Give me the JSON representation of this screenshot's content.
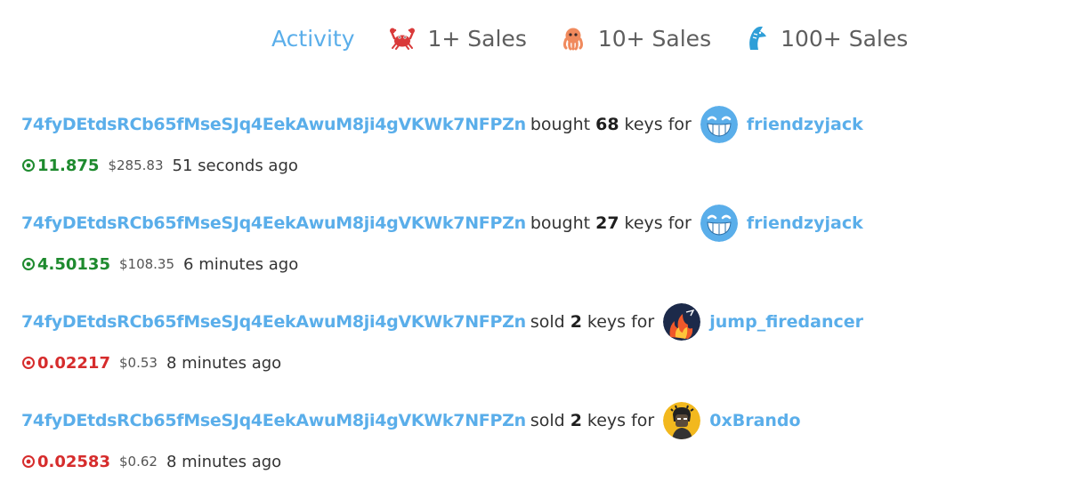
{
  "tabs": [
    {
      "label": "Activity",
      "icon": "activity-tab",
      "active": true
    },
    {
      "label": "1+ Sales",
      "icon": "crab-icon",
      "active": false
    },
    {
      "label": "10+ Sales",
      "icon": "octopus-icon",
      "active": false
    },
    {
      "label": "100+ Sales",
      "icon": "shark-icon",
      "active": false
    }
  ],
  "colors": {
    "accent": "#5aaeea",
    "buy": "#1e8a2e",
    "sell": "#d62c2c"
  },
  "activity": [
    {
      "trader": "74fyDEtdsRCb65fMseSJq4EekAwuM8ji4gVKWk7NFPZn",
      "verb": "bought",
      "qty": "68",
      "unit": "keys for",
      "subject": "friendzyjack",
      "avatar_icon": "grinning-face-avatar",
      "amount": "11.875",
      "usd": "$285.83",
      "time": "51 seconds ago",
      "side": "buy"
    },
    {
      "trader": "74fyDEtdsRCb65fMseSJq4EekAwuM8ji4gVKWk7NFPZn",
      "verb": "bought",
      "qty": "27",
      "unit": "keys for",
      "subject": "friendzyjack",
      "avatar_icon": "grinning-face-avatar",
      "amount": "4.50135",
      "usd": "$108.35",
      "time": "6 minutes ago",
      "side": "buy"
    },
    {
      "trader": "74fyDEtdsRCb65fMseSJq4EekAwuM8ji4gVKWk7NFPZn",
      "verb": "sold",
      "qty": "2",
      "unit": "keys for",
      "subject": "jump_firedancer",
      "avatar_icon": "fire-avatar",
      "amount": "0.02217",
      "usd": "$0.53",
      "time": "8 minutes ago",
      "side": "sell"
    },
    {
      "trader": "74fyDEtdsRCb65fMseSJq4EekAwuM8ji4gVKWk7NFPZn",
      "verb": "sold",
      "qty": "2",
      "unit": "keys for",
      "subject": "0xBrando",
      "avatar_icon": "pixel-character-avatar",
      "amount": "0.02583",
      "usd": "$0.62",
      "time": "8 minutes ago",
      "side": "sell"
    }
  ]
}
